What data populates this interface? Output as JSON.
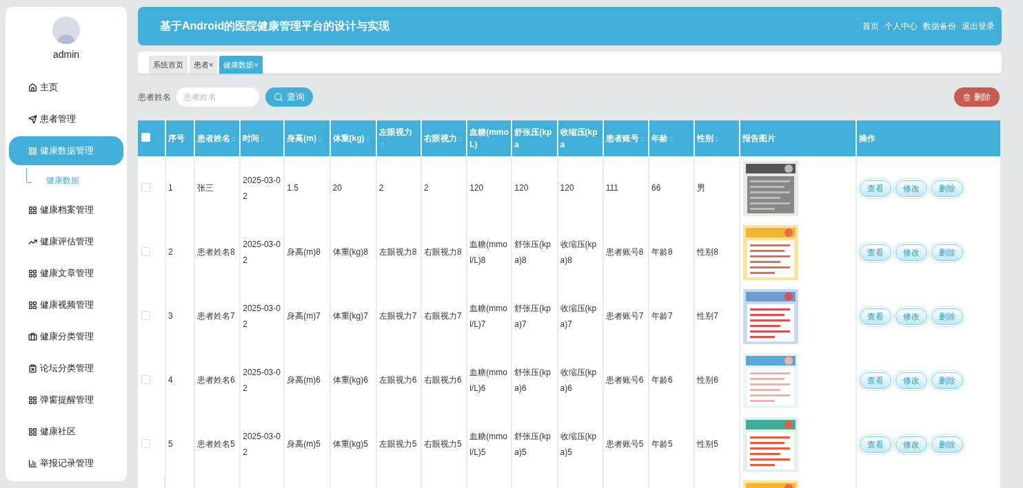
{
  "sidebar": {
    "user": "admin",
    "items": [
      {
        "label": "主页",
        "selected": false
      },
      {
        "label": "患者管理",
        "selected": false
      },
      {
        "label": "健康数据管理",
        "selected": true,
        "children": [
          {
            "label": "健康数据",
            "selected": true
          }
        ]
      },
      {
        "label": "健康档案管理",
        "selected": false
      },
      {
        "label": "健康评估管理",
        "selected": false
      },
      {
        "label": "健康文章管理",
        "selected": false
      },
      {
        "label": "健康视频管理",
        "selected": false
      },
      {
        "label": "健康分类管理",
        "selected": false
      },
      {
        "label": "论坛分类管理",
        "selected": false
      },
      {
        "label": "弹窗提醒管理",
        "selected": false
      },
      {
        "label": "健康社区",
        "selected": false
      },
      {
        "label": "举报记录管理",
        "selected": false
      }
    ]
  },
  "header": {
    "title": "基于Android的医院健康管理平台的设计与实现",
    "nav": [
      "首页",
      "个人中心",
      "数据备份",
      "退出登录"
    ]
  },
  "tabs": [
    {
      "label": "系统首页",
      "selected": false
    },
    {
      "label": "患者",
      "close": "×",
      "selected": false
    },
    {
      "label": "健康数据",
      "close": "×",
      "selected": true
    }
  ],
  "search": {
    "label": "患者姓名",
    "placeholder": "患者姓名",
    "button": "查询",
    "delete_button": "删除"
  },
  "table": {
    "select_all": {
      "checked": false
    },
    "columns": [
      {
        "label": "序号",
        "sortable": false
      },
      {
        "label": "患者姓名",
        "sortable": true
      },
      {
        "label": "时间",
        "sortable": true
      },
      {
        "label": "身高(m)",
        "sortable": true
      },
      {
        "label": "体重(kg)",
        "sortable": true
      },
      {
        "label": "左眼视力",
        "sortable": true
      },
      {
        "label": "右眼视力",
        "sortable": true
      },
      {
        "label": "血糖(mmoL)",
        "sortable": false
      },
      {
        "label": "舒张压(kpa",
        "sortable": false
      },
      {
        "label": "收缩压(kpa",
        "sortable": false
      },
      {
        "label": "患者账号",
        "sortable": true
      },
      {
        "label": "年龄",
        "sortable": true
      },
      {
        "label": "性别",
        "sortable": true
      },
      {
        "label": "报告图片",
        "sortable": false
      },
      {
        "label": "操作",
        "sortable": false
      }
    ],
    "rows": [
      {
        "checked": false,
        "cells": [
          "1",
          "张三",
          "2025-03-02",
          "1.5",
          "20",
          "2",
          "2",
          "120",
          "120",
          "120",
          "111",
          "66",
          "男"
        ],
        "report": {
          "kind": "picture"
        },
        "actions": [
          "查看",
          "修改",
          "删除"
        ]
      },
      {
        "checked": false,
        "cells": [
          "2",
          "患者姓名8",
          "2025-03-02",
          "身高(m)8",
          "体重(kg)8",
          "左眼视力8",
          "右眼视力8",
          "血糖(mmol/L)8",
          "舒张压(kpa)8",
          "收缩压(kpa)8",
          "患者账号8",
          "年龄8",
          "性别8"
        ],
        "report": {
          "kind": "picture"
        },
        "actions": [
          "查看",
          "修改",
          "删除"
        ]
      },
      {
        "checked": false,
        "cells": [
          "3",
          "患者姓名7",
          "2025-03-02",
          "身高(m)7",
          "体重(kg)7",
          "左眼视力7",
          "右眼视力7",
          "血糖(mmol/L)7",
          "舒张压(kpa)7",
          "收缩压(kpa)7",
          "患者账号7",
          "年龄7",
          "性别7"
        ],
        "report": {
          "kind": "picture"
        },
        "actions": [
          "查看",
          "修改",
          "删除"
        ]
      },
      {
        "checked": false,
        "cells": [
          "4",
          "患者姓名6",
          "2025-03-02",
          "身高(m)6",
          "体重(kg)6",
          "左眼视力6",
          "右眼视力6",
          "血糖(mmol/L)6",
          "舒张压(kpa)6",
          "收缩压(kpa)6",
          "患者账号6",
          "年龄6",
          "性别6"
        ],
        "report": {
          "kind": "picture"
        },
        "actions": [
          "查看",
          "修改",
          "删除"
        ]
      },
      {
        "checked": false,
        "cells": [
          "5",
          "患者姓名5",
          "2025-03-02",
          "身高(m)5",
          "体重(kg)5",
          "左眼视力5",
          "右眼视力5",
          "血糖(mmol/L)5",
          "舒张压(kpa)5",
          "收缩压(kpa)5",
          "患者账号5",
          "年龄5",
          "性别5"
        ],
        "report": {
          "kind": "picture"
        },
        "actions": [
          "查看",
          "修改",
          "删除"
        ]
      }
    ]
  }
}
